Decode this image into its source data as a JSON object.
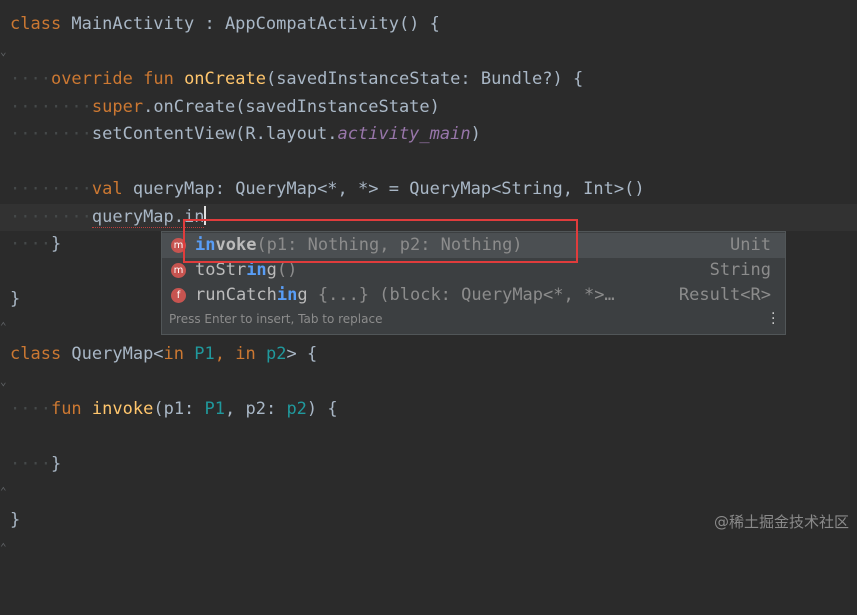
{
  "editor": {
    "line1": {
      "kw": "class",
      "name": " MainActivity : AppCompatActivity() {"
    },
    "line3": {
      "ws": "····",
      "kw1": "override",
      "kw2": "fun",
      "fn": "onCreate",
      "rest": "(savedInstanceState: Bundle?) {"
    },
    "line4": {
      "ws": "········",
      "kw": "super",
      "rest": ".onCreate(savedInstanceState)"
    },
    "line5": {
      "ws": "········",
      "a": "setContentView(R.layout.",
      "it": "activity_main",
      "b": ")"
    },
    "line7": {
      "ws": "········",
      "kw": "val",
      "a": " queryMap: QueryMap<*, *> ",
      "eq": "= QueryMap<String, Int>()"
    },
    "line8": {
      "ws": "········",
      "a": "queryMap.in"
    },
    "line9": {
      "ws": "····",
      "a": "}"
    },
    "line11": {
      "a": "}"
    },
    "line13": {
      "kw": "class",
      "a": " QueryMap<",
      "in1": "in",
      "p1": "P1",
      "comma": ", ",
      "in2": "in",
      "p2": "p2",
      "b": "> {"
    },
    "line15": {
      "ws": "····",
      "kw": "fun",
      "fn": "invoke",
      "a": "(p1: ",
      "t1": "P1",
      "c": ", p2: ",
      "t2": "p2",
      "b": ") {"
    },
    "line17": {
      "ws": "····",
      "a": "}"
    },
    "line19": {
      "a": "}"
    }
  },
  "popup": {
    "items": [
      {
        "badge": "m",
        "match": "in",
        "rest": "voke",
        "sig": "(p1: Nothing, p2: Nothing)",
        "ret": "Unit"
      },
      {
        "badge": "m",
        "pre": "toStr",
        "match": "in",
        "rest": "g",
        "sig": "()",
        "ret": "String"
      },
      {
        "badge": "f",
        "pre": "runCatch",
        "match": "in",
        "rest": "g",
        "sig": " {...} (block: QueryMap<*, *>…",
        "ret": "Result<R>"
      }
    ],
    "hint": "Press Enter to insert, Tab to replace",
    "menu_icon": "vertical-dots-icon"
  },
  "watermark": "@稀土掘金技术社区",
  "colors": {
    "background": "#2b2b2b",
    "keyword": "#cc7832",
    "function": "#ffc66d",
    "highlight": "#e03c3c",
    "match": "#589df6"
  }
}
